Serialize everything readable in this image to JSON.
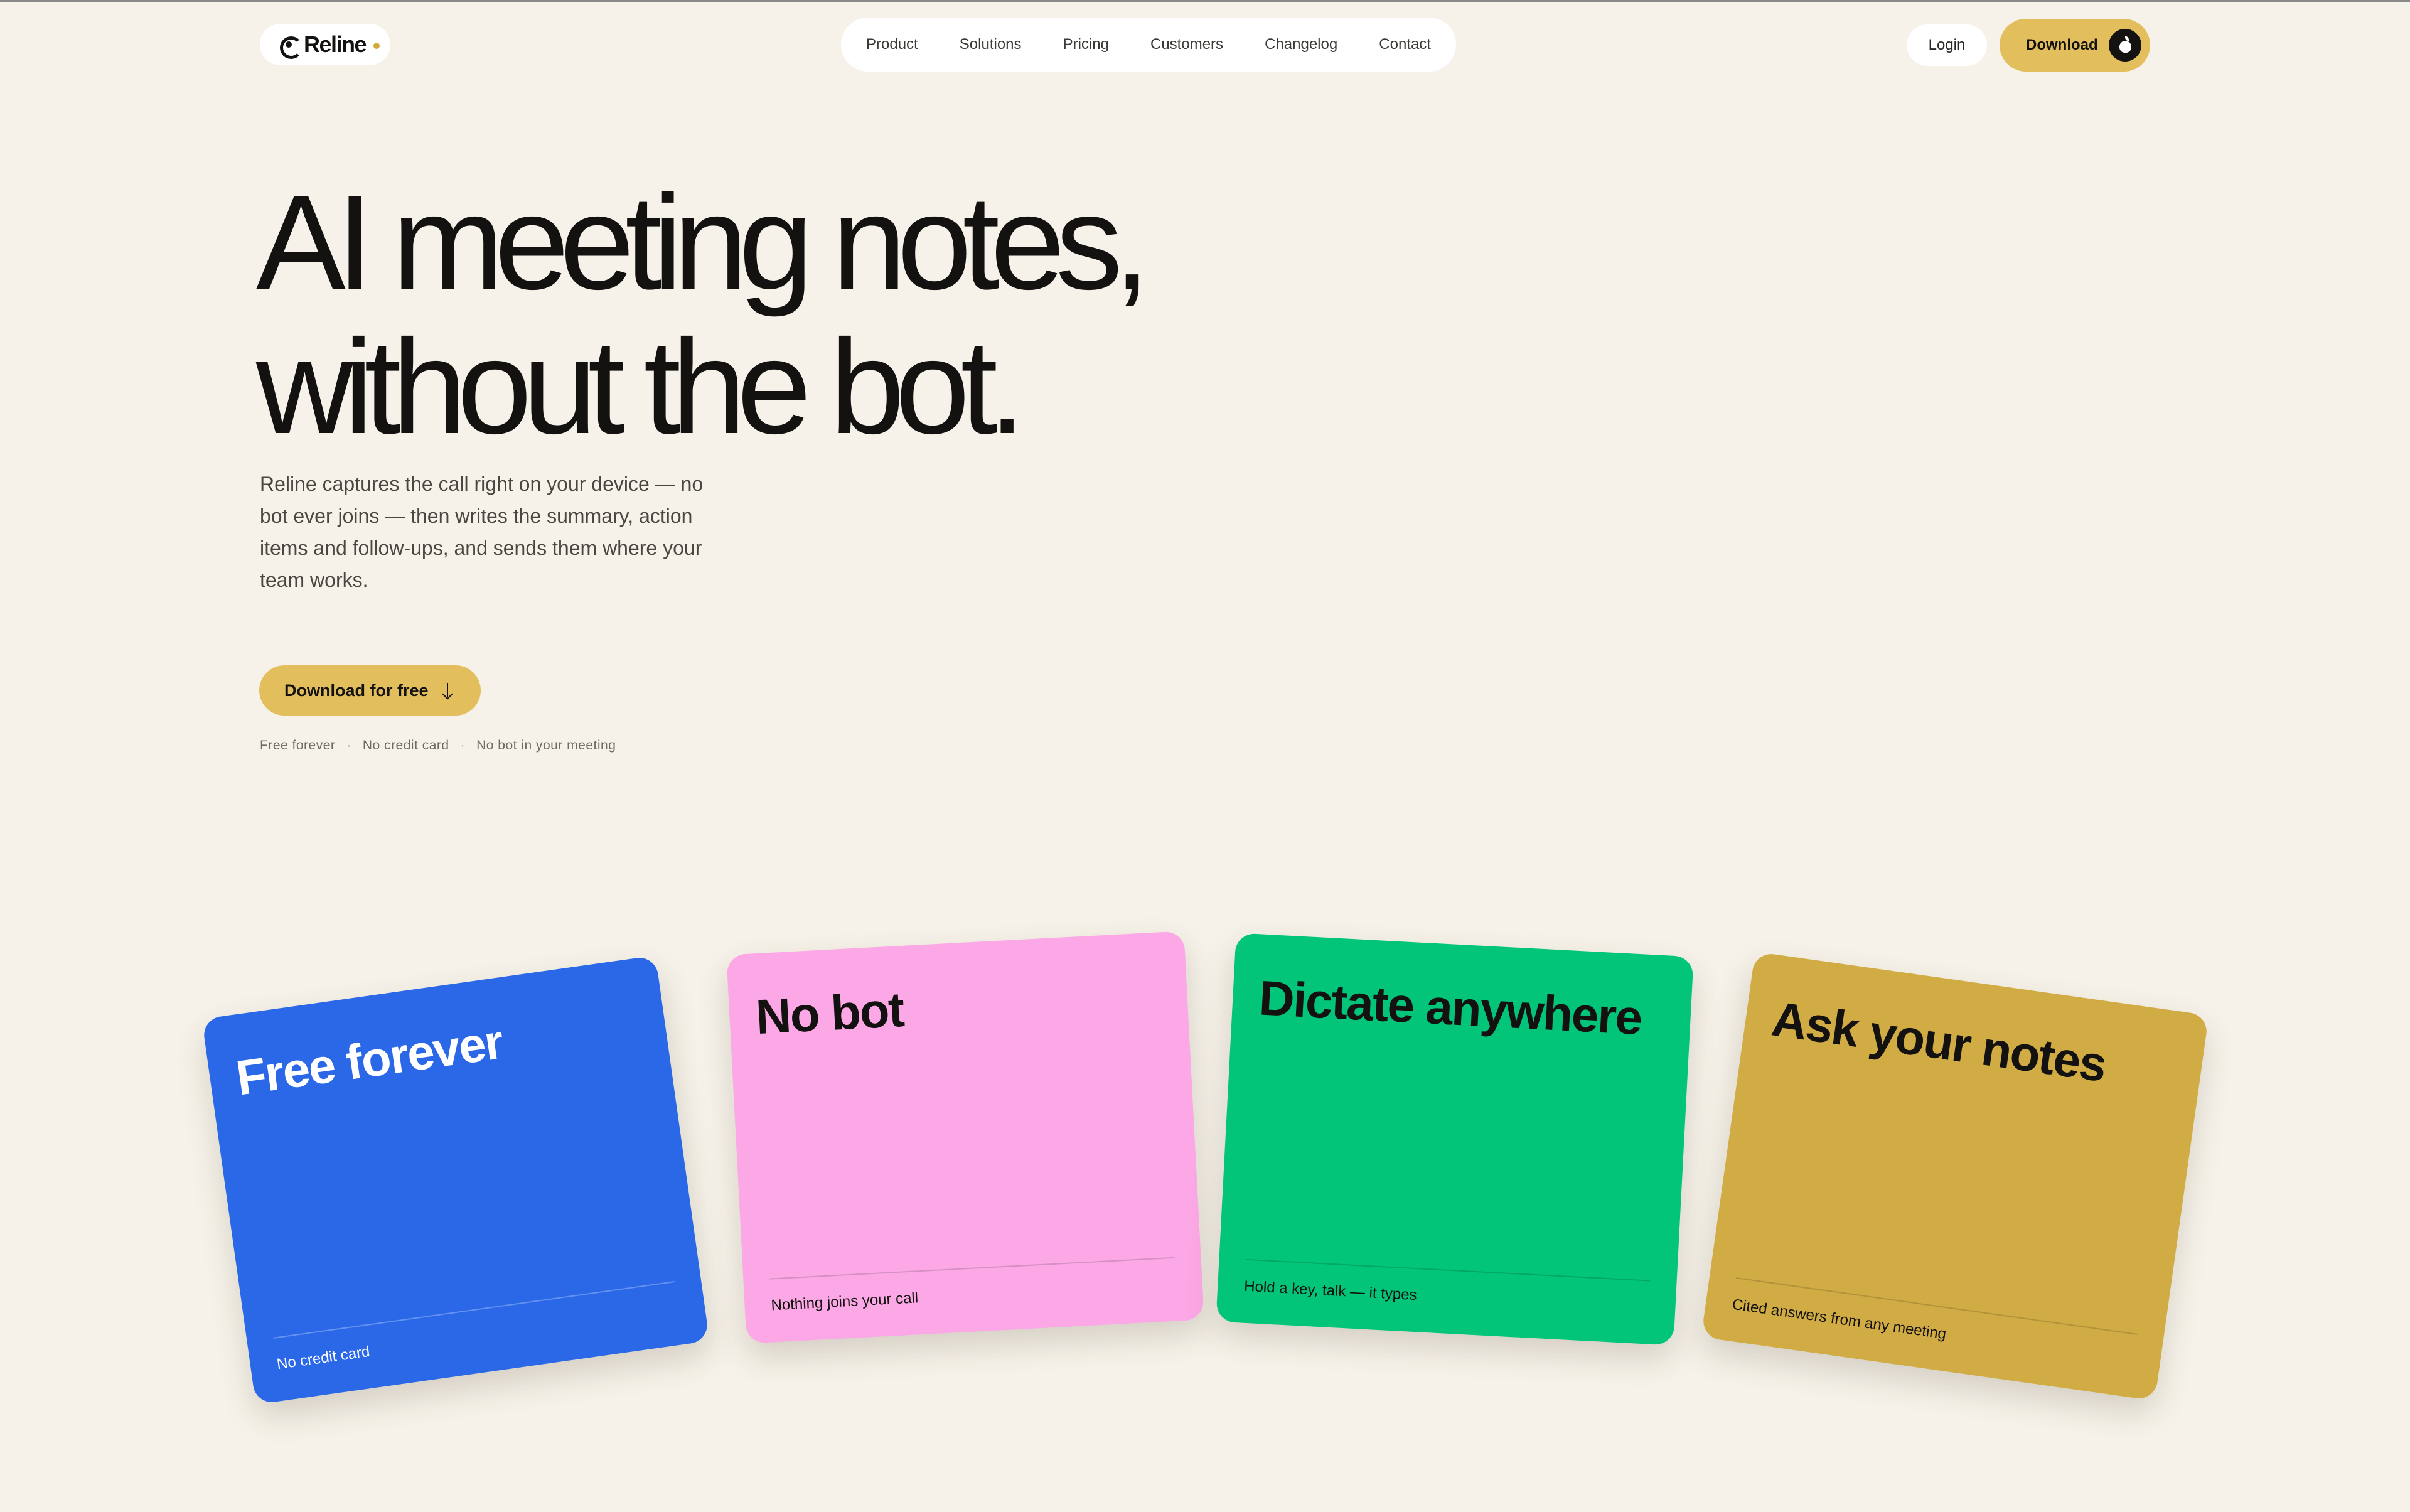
{
  "header": {
    "logo_text": "Reline",
    "nav": [
      {
        "label": "Product"
      },
      {
        "label": "Solutions"
      },
      {
        "label": "Pricing"
      },
      {
        "label": "Customers"
      },
      {
        "label": "Changelog"
      },
      {
        "label": "Contact"
      }
    ],
    "login_label": "Login",
    "download_label": "Download",
    "download_icon": "apple-icon"
  },
  "hero": {
    "title_line1": "AI meeting notes,",
    "title_line2": "without the bot.",
    "description": "Reline captures the call right on your device — no bot ever joins — then writes the summary, action items and follow-ups, and sends them where your team works.",
    "cta_label": "Download for free",
    "cta_icon": "arrow-down-icon",
    "perks": [
      "Free forever",
      "No credit card",
      "No bot in your meeting"
    ],
    "perk_separator": "·"
  },
  "cards": [
    {
      "title": "Free forever",
      "subtitle": "No credit card",
      "color": "#2a68e8"
    },
    {
      "title": "No bot",
      "subtitle": "Nothing joins your call",
      "color": "#fca8e6"
    },
    {
      "title": "Dictate anywhere",
      "subtitle": "Hold a key, talk — it types",
      "color": "#02c57a"
    },
    {
      "title": "Ask your notes",
      "subtitle": "Cited answers from any meeting",
      "color": "#d1ac45"
    }
  ],
  "colors": {
    "background": "#f6f2e9",
    "accent": "#e2be5d",
    "text": "#141210"
  }
}
